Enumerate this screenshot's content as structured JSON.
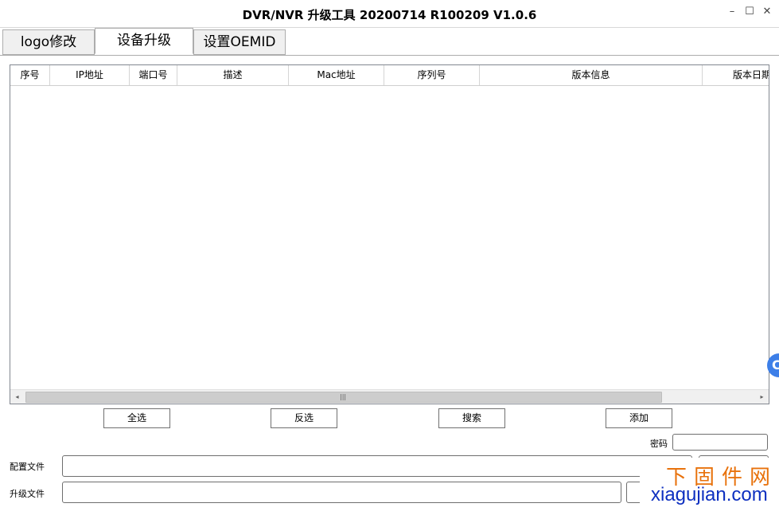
{
  "window": {
    "title": "DVR/NVR 升级工具 20200714 R100209 V1.0.6",
    "min": "–",
    "max": "☐",
    "close": "✕"
  },
  "tabs": [
    "logo修改",
    "设备升级",
    "设置OEMID"
  ],
  "grid": {
    "columns": [
      "序号",
      "IP地址",
      "端口号",
      "描述",
      "Mac地址",
      "序列号",
      "版本信息",
      "版本日期"
    ],
    "rows": [],
    "scroll": {
      "left": "◂",
      "right": "▸",
      "grip": "|||"
    }
  },
  "actions": {
    "select_all": "全选",
    "invert": "反选",
    "search": "搜索",
    "add": "添加"
  },
  "form": {
    "password_label": "密码",
    "config_label": "配置文件",
    "upgrade_label": "升级文件"
  },
  "watermark": {
    "cn": "下固件网",
    "en": "xiagujian.com"
  },
  "side_badge": "C"
}
